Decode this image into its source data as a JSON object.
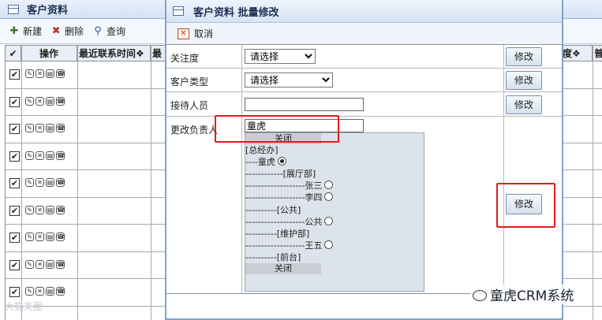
{
  "bg_window": {
    "title": "客户资料",
    "toolbar": {
      "new_label": "新建",
      "delete_label": "删除",
      "query_label": "查询"
    },
    "columns": {
      "select": "✔",
      "actions": "操作",
      "last_contact": "最近联系时间❖",
      "last_contact2": "最",
      "attention": "度❖",
      "common": "普"
    },
    "row_count": 9
  },
  "modal": {
    "title": "客户资料 批量修改",
    "cancel_label": "取消",
    "rows": [
      {
        "label": "关注度",
        "value": "请选择",
        "button": "修改"
      },
      {
        "label": "客户类型",
        "value": "请选择",
        "button": "修改"
      },
      {
        "label": "接待人员",
        "value": "",
        "button": "修改"
      },
      {
        "label": "更改负责人",
        "value": "童虎",
        "button": "修改"
      }
    ],
    "tree": {
      "close_top": "关闭",
      "close_bottom": "关闭",
      "items": [
        "[总经办]",
        "----童虎",
        "------------[展厅部]",
        "-------------------张三",
        "-------------------李四",
        "----------[公共]",
        "-------------------公共",
        "----------[维护部]",
        "-------------------王五",
        "----------[前台]"
      ],
      "selected": "童虎"
    }
  },
  "watermark_left": "大猫美圈",
  "watermark_right": "童虎CRM系统"
}
